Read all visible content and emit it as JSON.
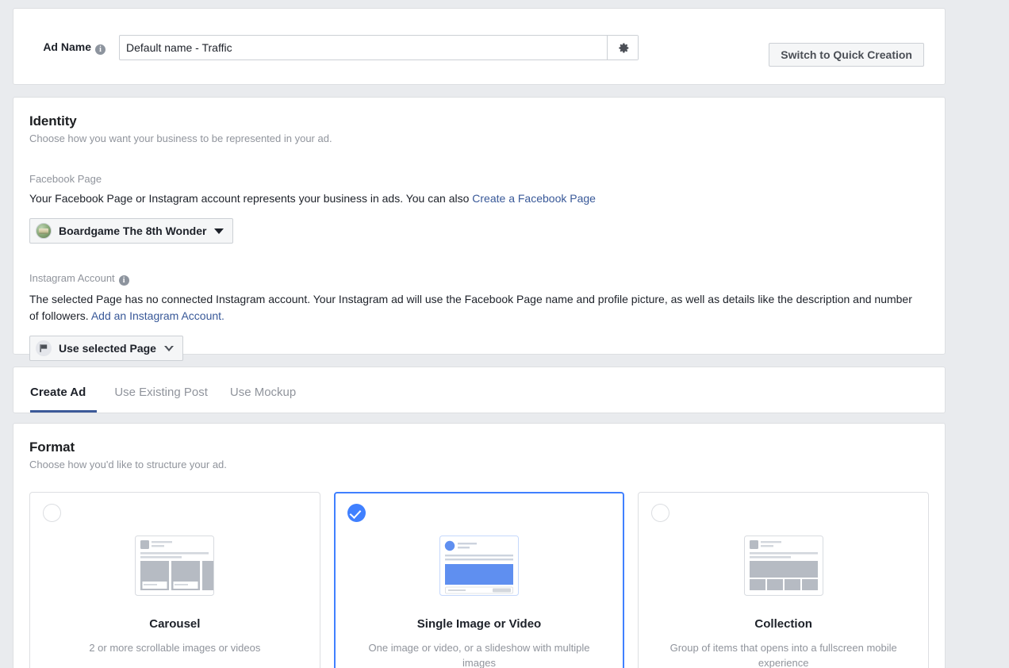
{
  "ad_name": {
    "label": "Ad Name",
    "info_icon": "info-icon",
    "value": "Default name - Traffic",
    "placeholder": "Ad name",
    "gear_icon": "gear-icon"
  },
  "header": {
    "switch_button": "Switch to Quick Creation"
  },
  "identity": {
    "title": "Identity",
    "subtitle": "Choose how you want your business to be represented in your ad.",
    "facebook_page": {
      "label": "Facebook Page",
      "description_before": "Your Facebook Page or Instagram account represents your business in ads. You can also ",
      "link": "Create a Facebook Page",
      "selected_page": "Boardgame The 8th Wonder",
      "page_avatar_icon": "page-avatar",
      "caret_icon": "chevron-down-icon"
    },
    "instagram_account": {
      "label": "Instagram Account",
      "info_icon": "info-icon",
      "description_before": "The selected Page has no connected Instagram account. Your Instagram ad will use the Facebook Page name and profile picture, as well as details like the description and number of followers. ",
      "link": "Add an Instagram Account.",
      "selected_option": "Use selected Page",
      "option_icon": "page-flag-icon",
      "caret_icon": "chevron-down-outline-icon"
    }
  },
  "tabs": [
    {
      "label": "Create Ad",
      "active": true
    },
    {
      "label": "Use Existing Post",
      "active": false
    },
    {
      "label": "Use Mockup",
      "active": false
    }
  ],
  "format": {
    "title": "Format",
    "subtitle": "Choose how you'd like to structure your ad.",
    "options": [
      {
        "name": "Carousel",
        "description": "2 or more scrollable images or videos",
        "selected": false,
        "thumb": "carousel-thumbnail"
      },
      {
        "name": "Single Image or Video",
        "description": "One image or video, or a slideshow with multiple images",
        "selected": true,
        "thumb": "single-image-thumbnail"
      },
      {
        "name": "Collection",
        "description": "Group of items that opens into a fullscreen mobile experience",
        "selected": false,
        "thumb": "collection-thumbnail"
      }
    ]
  },
  "colors": {
    "page_background": "#e9ebee",
    "card_background": "#ffffff",
    "border": "#dddfe2",
    "accent_blue": "#4080ff",
    "tab_active_underline": "#3b5998",
    "link": "#385898",
    "muted_text": "#90949c",
    "primary_text": "#1d2129"
  }
}
